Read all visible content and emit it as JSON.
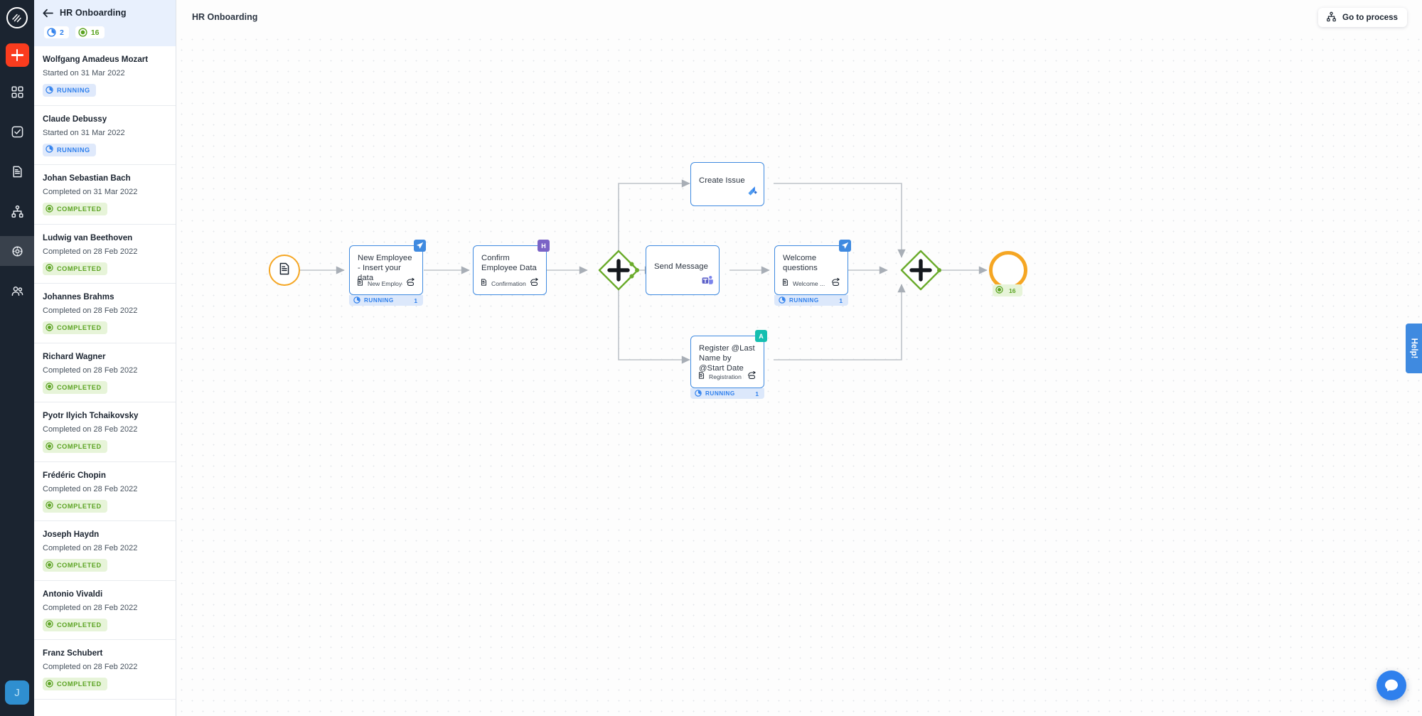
{
  "rail": {
    "logo_icon": "app-logo-icon",
    "add_label": "+",
    "items": [
      {
        "icon": "grid-apps-icon",
        "name": "apps",
        "selected": false
      },
      {
        "icon": "checkbox-tasks-icon",
        "name": "tasks",
        "selected": false
      },
      {
        "icon": "document-icon",
        "name": "documents",
        "selected": false
      },
      {
        "icon": "org-chart-icon",
        "name": "processes",
        "selected": false
      },
      {
        "icon": "gear-cog-icon",
        "name": "settings",
        "selected": true
      },
      {
        "icon": "people-icon",
        "name": "people",
        "selected": false
      }
    ],
    "avatar_initial": "J"
  },
  "list_panel": {
    "back_icon": "arrow-left-icon",
    "title": "HR Onboarding",
    "counts": [
      {
        "icon": "running-icon",
        "value": "2",
        "kind": "running"
      },
      {
        "icon": "completed-icon",
        "value": "16",
        "kind": "completed"
      }
    ],
    "rows": [
      {
        "name": "Wolfgang Amadeus Mozart",
        "date": "Started on 31 Mar 2022",
        "status": "RUNNING",
        "kind": "running"
      },
      {
        "name": "Claude Debussy",
        "date": "Started on 31 Mar 2022",
        "status": "RUNNING",
        "kind": "running"
      },
      {
        "name": "Johan Sebastian Bach",
        "date": "Completed on 31 Mar 2022",
        "status": "COMPLETED",
        "kind": "completed"
      },
      {
        "name": "Ludwig van Beethoven",
        "date": "Completed on 28 Feb 2022",
        "status": "COMPLETED",
        "kind": "completed"
      },
      {
        "name": "Johannes Brahms",
        "date": "Completed on 28 Feb 2022",
        "status": "COMPLETED",
        "kind": "completed"
      },
      {
        "name": "Richard Wagner",
        "date": "Completed on 28 Feb 2022",
        "status": "COMPLETED",
        "kind": "completed"
      },
      {
        "name": "Pyotr Ilyich Tchaikovsky",
        "date": "Completed on 28 Feb 2022",
        "status": "COMPLETED",
        "kind": "completed"
      },
      {
        "name": "Frédéric Chopin",
        "date": "Completed on 28 Feb 2022",
        "status": "COMPLETED",
        "kind": "completed"
      },
      {
        "name": "Joseph Haydn",
        "date": "Completed on 28 Feb 2022",
        "status": "COMPLETED",
        "kind": "completed"
      },
      {
        "name": "Antonio Vivaldi",
        "date": "Completed on 28 Feb 2022",
        "status": "COMPLETED",
        "kind": "completed"
      },
      {
        "name": "Franz Schubert",
        "date": "Completed on 28 Feb 2022",
        "status": "COMPLETED",
        "kind": "completed"
      }
    ]
  },
  "canvas": {
    "title": "HR Onboarding",
    "go_to_process": {
      "label": "Go to process",
      "icon": "org-chart-icon"
    },
    "help_tab": "Help!",
    "intercom_icon": "chat-bubble-icon",
    "end_badge": {
      "icon": "completed-icon",
      "value": "16"
    }
  },
  "diagram": {
    "start_event": {
      "name": "start-event",
      "icon": "document-icon"
    },
    "end_event": {
      "name": "end-event"
    },
    "gateways": [
      {
        "name": "parallel-gateway-split",
        "type": "parallel"
      },
      {
        "name": "parallel-gateway-join",
        "type": "parallel"
      }
    ],
    "nodes": [
      {
        "id": "new-employee",
        "title": "New Employee - Insert your data",
        "form": "New Employee ...",
        "corner_badge": "send",
        "corner_label": "",
        "status": "RUNNING",
        "status_count": "1"
      },
      {
        "id": "confirm-employee-data",
        "title": "Confirm Employee Data",
        "form": "Confirmation Ne...",
        "corner_badge": "h",
        "corner_label": "H",
        "status": "",
        "status_count": ""
      },
      {
        "id": "create-issue",
        "title": "Create Issue",
        "form": "",
        "corner_badge": "",
        "corner_label": "",
        "brand_icon": "jira-icon",
        "status": "",
        "status_count": ""
      },
      {
        "id": "send-message",
        "title": "Send Message",
        "form": "",
        "corner_badge": "",
        "corner_label": "",
        "brand_icon": "teams-icon",
        "status": "",
        "status_count": ""
      },
      {
        "id": "welcome-questions",
        "title": "Welcome questions",
        "form": "Welcome ...",
        "corner_badge": "send",
        "corner_label": "",
        "status": "RUNNING",
        "status_count": "1"
      },
      {
        "id": "register-last-name",
        "title": "Register @Last Name by @Start Date",
        "form": "Registration New ...",
        "corner_badge": "a",
        "corner_label": "A",
        "status": "RUNNING",
        "status_count": "1"
      }
    ]
  },
  "colors": {
    "accent_red": "#fa3c1e",
    "accent_blue": "#2f80ed",
    "node_border": "#3f8ae0",
    "gateway_green": "#6aab2b",
    "event_orange": "#f5a623",
    "rail_dark": "#1b2430"
  }
}
